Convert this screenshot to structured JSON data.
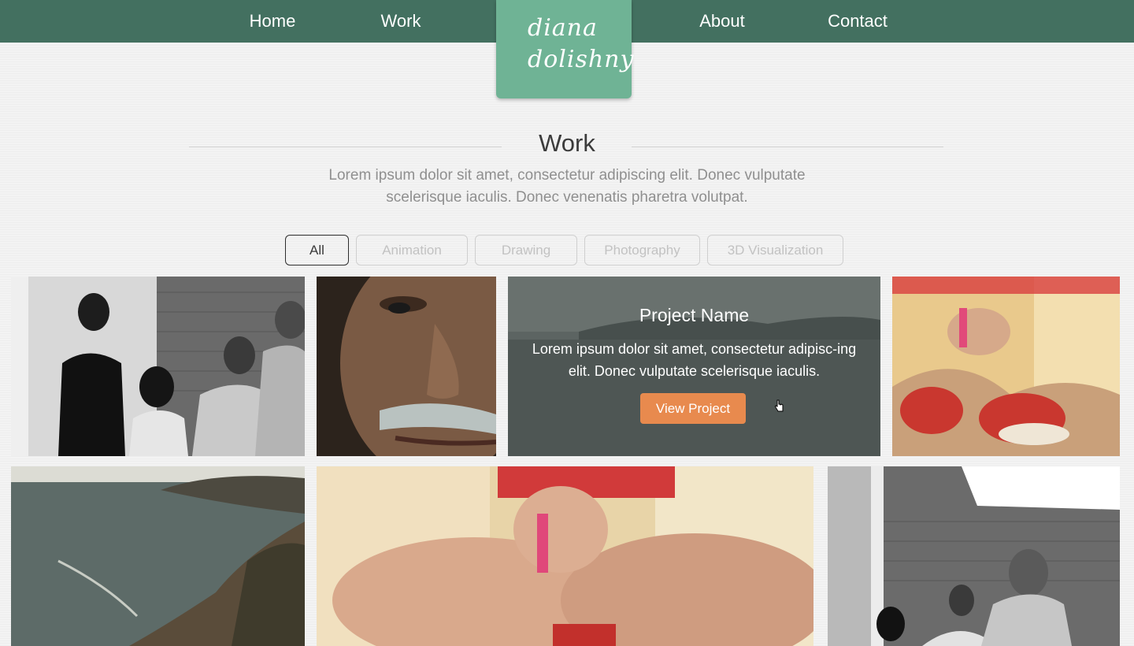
{
  "nav": {
    "home": "Home",
    "work": "Work",
    "about": "About",
    "contact": "Contact"
  },
  "logo": {
    "line1": "diana",
    "line2": "dolishny"
  },
  "section": {
    "title": "Work",
    "description": "Lorem ipsum dolor sit amet, consectetur adipiscing elit. Donec vulputate scelerisque iaculis. Donec venenatis pharetra volutpat."
  },
  "filters": {
    "all": "All",
    "animation": "Animation",
    "drawing": "Drawing",
    "photography": "Photography",
    "visualization": "3D Visualization",
    "selected": "All"
  },
  "project_overlay": {
    "title": "Project Name",
    "description": "Lorem ipsum dolor sit amet, consectetur adipisc-ing elit. Donec vulputate scelerisque iaculis.",
    "button": "View Project"
  },
  "colors": {
    "topbar": "#437060",
    "logo_bg": "#6fb395",
    "button": "#e88a4e",
    "title": "#3b3b3b",
    "muted": "#8f8f8f"
  },
  "gallery": {
    "tiles": [
      {
        "subject": "group-bw-photo"
      },
      {
        "subject": "old-man-portrait-photo"
      },
      {
        "subject": "coastline-photo",
        "hovered": true
      },
      {
        "subject": "red-sneakers-photo"
      },
      {
        "subject": "coastline-photo"
      },
      {
        "subject": "red-sneakers-closeup-photo"
      },
      {
        "subject": "group-bw-photo"
      }
    ]
  }
}
